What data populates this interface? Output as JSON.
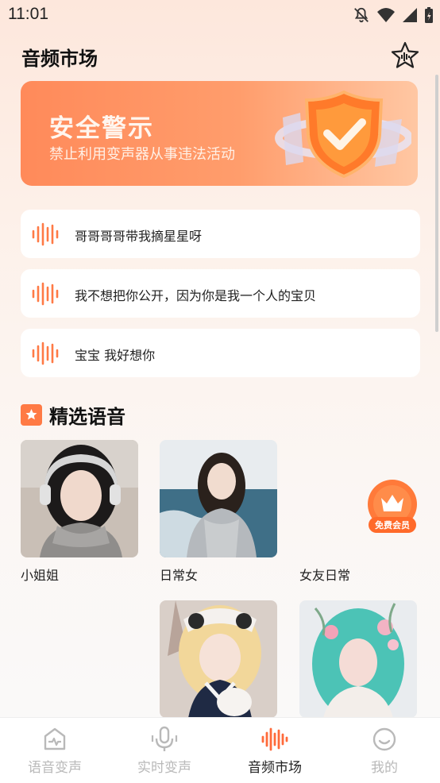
{
  "status_bar": {
    "time": "11:01"
  },
  "header": {
    "title": "音频市场"
  },
  "banner": {
    "title": "安全警示",
    "subtitle": "禁止利用变声器从事违法活动"
  },
  "audio_list": [
    {
      "text": "哥哥哥哥带我摘星星呀"
    },
    {
      "text": "我不想把你公开，因为你是我一个人的宝贝"
    },
    {
      "text": "宝宝 我好想你"
    }
  ],
  "featured": {
    "title": "精选语音",
    "cards": [
      {
        "name": "小姐姐"
      },
      {
        "name": "日常女"
      },
      {
        "name": "女友日常"
      }
    ]
  },
  "vip_badge": {
    "label": "免费会员"
  },
  "tabs": [
    {
      "label": "语音变声",
      "icon": "chart-screen-icon"
    },
    {
      "label": "实时变声",
      "icon": "microphone-icon"
    },
    {
      "label": "音频市场",
      "icon": "sound-wave-icon",
      "active": true
    },
    {
      "label": "我的",
      "icon": "smiley-icon"
    }
  ],
  "colors": {
    "accent": "#ff7a45",
    "banner_start": "#ff8a5a",
    "banner_end": "#ffc7a3",
    "inactive": "#b9b9b9"
  }
}
